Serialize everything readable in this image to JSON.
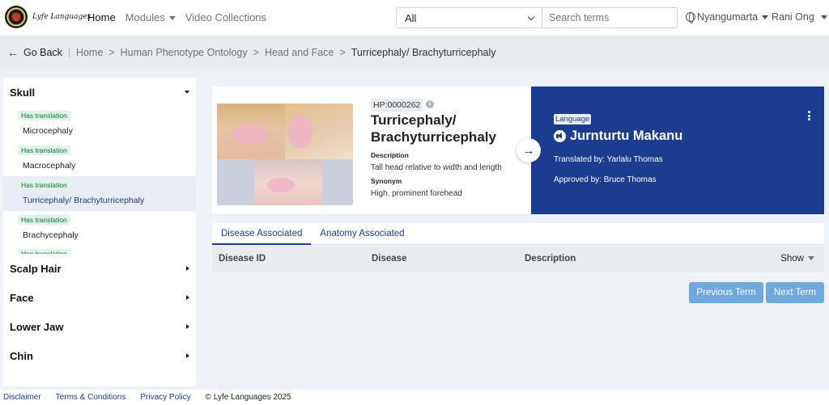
{
  "brand": {
    "name": "Lyfe Languages"
  },
  "nav": {
    "links": [
      {
        "label": "Home",
        "active": true,
        "dropdown": false
      },
      {
        "label": "Modules",
        "active": false,
        "dropdown": true
      },
      {
        "label": "Video Collections",
        "active": false,
        "dropdown": false
      }
    ],
    "filter_selected": "All",
    "search_placeholder": "Search terms",
    "language": "Nyangumarta",
    "user": "Rani Ong"
  },
  "breadcrumb": {
    "back_label": "Go Back",
    "items": [
      "Home",
      "Human Phenotype Ontology",
      "Head and Face",
      "Turricephaly/ Brachyturricephaly"
    ]
  },
  "sidebar": {
    "groups": [
      {
        "label": "Skull",
        "expanded": true,
        "terms": [
          {
            "badge": "Has translation",
            "name": "Microcephaly",
            "selected": false
          },
          {
            "badge": "Has translation",
            "name": "Macrocephaly",
            "selected": false
          },
          {
            "badge": "Has translation",
            "name": "Turricephaly/ Brachyturricephaly",
            "selected": true
          },
          {
            "badge": "Has translation",
            "name": "Brachycephaly",
            "selected": false
          }
        ]
      },
      {
        "label": "Scalp Hair",
        "expanded": false
      },
      {
        "label": "Face",
        "expanded": false
      },
      {
        "label": "Lower Jaw",
        "expanded": false
      },
      {
        "label": "Chin",
        "expanded": false
      }
    ]
  },
  "term": {
    "id": "HP:0000262",
    "title": "Turricephaly/ Brachyturricephaly",
    "description_label": "Description",
    "description": "Tall head relative to width and length",
    "synonym_label": "Synonym",
    "synonym": "High, prominent forehead"
  },
  "translation": {
    "tag": "Language",
    "word": "Jurnturtu Makanu",
    "translated_by": "Translated by: Yarlalu Thomas",
    "approved_by": "Approved by: Bruce Thomas",
    "bg_color": "#1c3d8f"
  },
  "tabs": [
    {
      "label": "Disease Associated",
      "active": true
    },
    {
      "label": "Anatomy Associated",
      "active": false
    }
  ],
  "table": {
    "columns": [
      "Disease ID",
      "Disease",
      "Description"
    ],
    "show_label": "Show"
  },
  "pager": {
    "prev": "Previous Term",
    "next": "Next Term"
  },
  "footer": {
    "links": [
      "Disclaimer",
      "Terms & Conditions",
      "Privacy Policy"
    ],
    "copyright": "© Lyfe Languages 2025"
  }
}
